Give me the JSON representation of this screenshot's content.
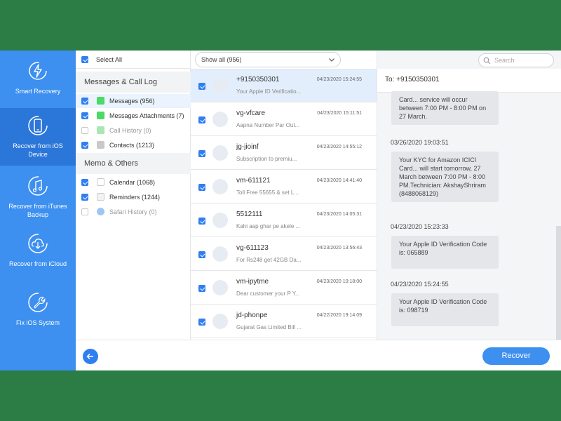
{
  "nav": [
    {
      "label": "Smart Recovery"
    },
    {
      "label": "Recover from iOS Device"
    },
    {
      "label": "Recover from iTunes Backup"
    },
    {
      "label": "Recover from iCloud"
    },
    {
      "label": "Fix iOS System"
    }
  ],
  "categories": {
    "select_all": "Select All",
    "group1_title": "Messages & Call Log",
    "group2_title": "Memo & Others",
    "items": [
      {
        "label": "Messages (956)"
      },
      {
        "label": "Messages Attachments (7)"
      },
      {
        "label": "Call History (0)"
      },
      {
        "label": "Contacts (1213)"
      },
      {
        "label": "Calendar (1068)"
      },
      {
        "label": "Reminders (1244)"
      },
      {
        "label": "Safari History (0)"
      }
    ]
  },
  "list": {
    "filter": "Show all (956)",
    "rows": [
      {
        "name": "+9150350301",
        "date": "04/23/2020 15:24:55",
        "preview": "Your Apple ID Verificatio..."
      },
      {
        "name": "vg-vfcare",
        "date": "04/23/2020 15:11:51",
        "preview": "Aapna Number Par Out..."
      },
      {
        "name": "jg-jioinf",
        "date": "04/23/2020 14:55:12",
        "preview": "Subscription to premiu..."
      },
      {
        "name": "vm-611121",
        "date": "04/23/2020 14:41:40",
        "preview": "Toll Free 55655 & set L..."
      },
      {
        "name": "5512111",
        "date": "04/23/2020 14:05:31",
        "preview": "Kahi aap ghar pe akele ..."
      },
      {
        "name": "vg-611123",
        "date": "04/23/2020 13:56:43",
        "preview": "For Rs248 get 42GB Da..."
      },
      {
        "name": "vm-ipytme",
        "date": "04/23/2020 10:18:00",
        "preview": "Dear customer your P Y..."
      },
      {
        "name": "jd-phonpe",
        "date": "04/22/2020 19:14:09",
        "preview": "Gujarat Gas Limited Bill ..."
      }
    ]
  },
  "convo": {
    "search_placeholder": "Search",
    "to_label": "To:  +9150350301",
    "bubble1": "Card... service will occur between 7:00 PM - 8:00 PM on 27 March.",
    "ts2": "03/26/2020 19:03:51",
    "bubble2": "Your KYC for Amazon ICICI Card... will start tomorrow, 27 March between 7:00 PM - 8:00 PM.Technician: AkshayShriram (8488068129)",
    "ts3": "04/23/2020 15:23:33",
    "bubble3": "Your Apple ID Verification Code is: 065889",
    "ts4": "04/23/2020 15:24:55",
    "bubble4": "Your Apple ID Verification Code is: 098719"
  },
  "bottom": {
    "recover_label": "Recover"
  },
  "colors": {
    "nav_bg": "#3d8ff0",
    "nav_active": "#2b76d9",
    "accent": "#2f7ff0",
    "outer_bg": "#2c7d45"
  }
}
